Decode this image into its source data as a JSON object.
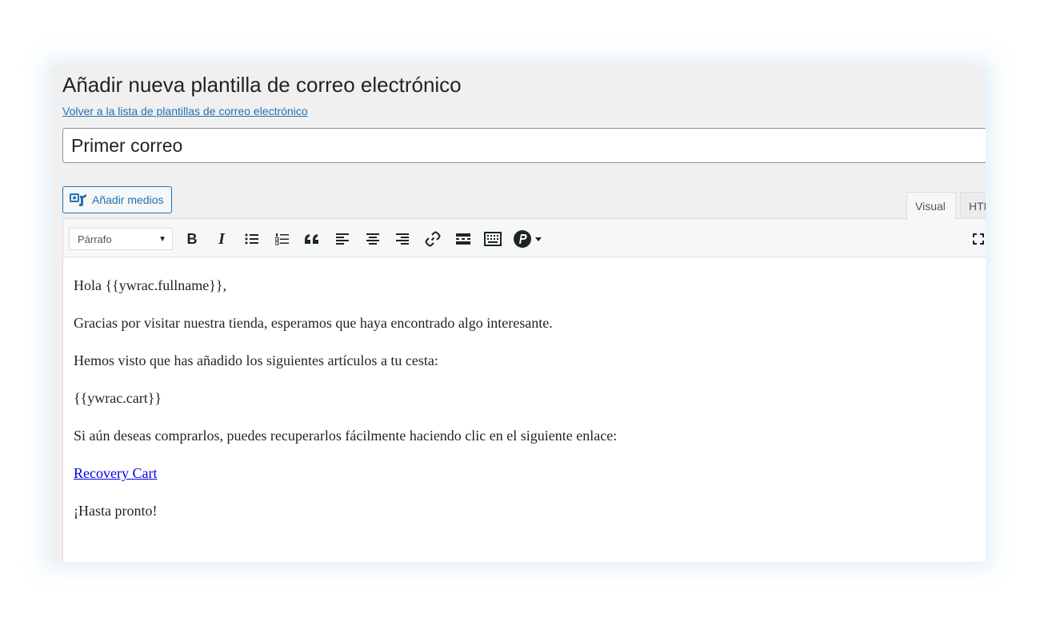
{
  "page": {
    "title": "Añadir nueva plantilla de correo electrónico",
    "back_link": "Volver a la lista de plantillas de correo electrónico"
  },
  "title_field": {
    "value": "Primer correo"
  },
  "media": {
    "add_media_label": "Añadir medios",
    "icon": "add-media-icon"
  },
  "editor_tabs": [
    {
      "label": "Visual",
      "active": true
    },
    {
      "label": "HTML",
      "active": false
    }
  ],
  "toolbar": {
    "format_select": {
      "selected": "Párrafo",
      "caret": "▼"
    },
    "buttons": [
      {
        "name": "bold",
        "icon": "bold-icon",
        "glyph": "B"
      },
      {
        "name": "italic",
        "icon": "italic-icon",
        "glyph": "I"
      },
      {
        "name": "bulleted-list",
        "icon": "bulleted-list-icon"
      },
      {
        "name": "numbered-list",
        "icon": "numbered-list-icon"
      },
      {
        "name": "blockquote",
        "icon": "blockquote-icon",
        "glyph": "66"
      },
      {
        "name": "align-left",
        "icon": "align-left-icon"
      },
      {
        "name": "align-center",
        "icon": "align-center-icon"
      },
      {
        "name": "align-right",
        "icon": "align-right-icon"
      },
      {
        "name": "insert-link",
        "icon": "link-icon"
      },
      {
        "name": "read-more",
        "icon": "read-more-icon"
      },
      {
        "name": "toolbar-toggle",
        "icon": "keyboard-icon"
      },
      {
        "name": "shortcode-dropdown",
        "icon": "plugin-dropdown-icon"
      },
      {
        "name": "fullscreen",
        "icon": "fullscreen-icon"
      }
    ]
  },
  "content": {
    "greeting": "Hola {{ywrac.fullname}},",
    "thanks": "Gracias por visitar nuestra tienda, esperamos que haya encontrado algo interesante.",
    "seen": "Hemos visto que has añadido los siguientes artículos a tu cesta:",
    "cart_placeholder": "{{ywrac.cart}}",
    "recover": "Si aún deseas comprarlos, puedes recuperarlos fácilmente haciendo clic en el siguiente enlace:",
    "recovery_link": "Recovery Cart",
    "closing": "¡Hasta pronto!"
  },
  "colors": {
    "admin_background": "#f0f0f1",
    "link_blue": "#2271b1",
    "content_link": "#0000ee",
    "text": "#1d2327"
  }
}
